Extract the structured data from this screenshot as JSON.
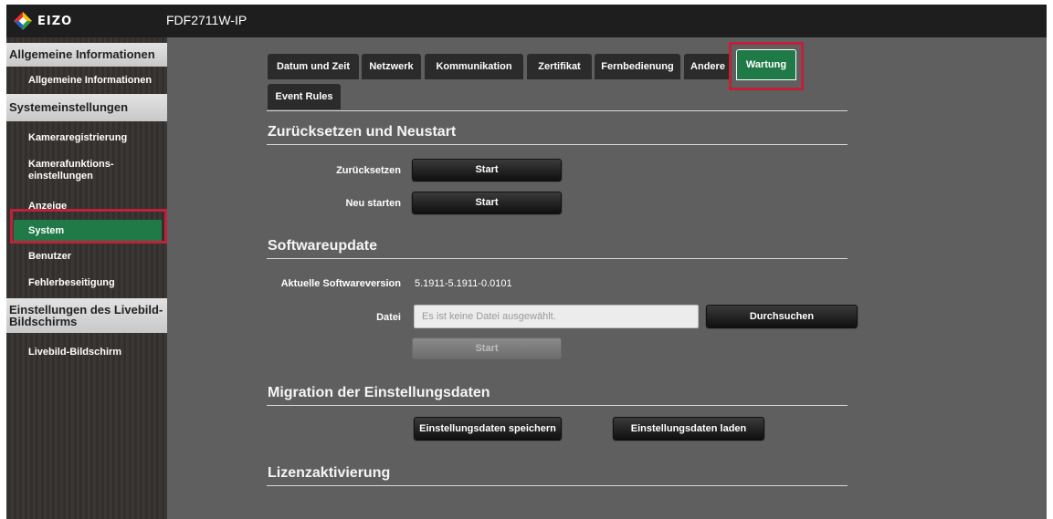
{
  "header": {
    "logo_text": "EIZO",
    "device_title": "FDF2711W-IP"
  },
  "sidebar": {
    "sections": [
      {
        "title": "Allgemeine Informationen",
        "items": [
          {
            "label": "Allgemeine Informationen"
          }
        ]
      },
      {
        "title": "Systemeinstellungen",
        "items": [
          {
            "label": "Kameraregistrierung"
          },
          {
            "label": "Kamerafunktions- einstellungen"
          },
          {
            "label": "Anzeige"
          },
          {
            "label": "System",
            "active": true
          },
          {
            "label": "Benutzer"
          },
          {
            "label": "Fehlerbeseitigung"
          }
        ]
      },
      {
        "title": "Einstellungen des Livebild-Bildschirms",
        "items": [
          {
            "label": "Livebild-Bildschirm"
          }
        ]
      }
    ]
  },
  "tabs": [
    {
      "label": "Datum und Zeit"
    },
    {
      "label": "Netzwerk"
    },
    {
      "label": "Kommunikation"
    },
    {
      "label": "Zertifikat"
    },
    {
      "label": "Fernbedienung"
    },
    {
      "label": "Andere"
    },
    {
      "label": "Wartung",
      "active": true
    },
    {
      "label": "Event Rules"
    }
  ],
  "reset_section": {
    "title": "Zurücksetzen und Neustart",
    "reset_label": "Zurücksetzen",
    "reset_button": "Start",
    "restart_label": "Neu starten",
    "restart_button": "Start"
  },
  "update_section": {
    "title": "Softwareupdate",
    "version_label": "Aktuelle Softwareversion",
    "version_value": "5.1911-5.1911-0.0101",
    "file_label": "Datei",
    "file_placeholder": "Es ist keine Datei ausgewählt.",
    "browse_button": "Durchsuchen",
    "start_button": "Start"
  },
  "migration_section": {
    "title": "Migration der Einstellungsdaten",
    "save_button": "Einstellungsdaten speichern",
    "load_button": "Einstellungsdaten laden"
  },
  "license_section": {
    "title": "Lizenzaktivierung"
  },
  "colors": {
    "accent": "#1f7a48",
    "highlight": "#c0203a",
    "topbar": "#1e1e1e",
    "main_bg": "#5f5f5f"
  },
  "icons": {
    "logo": "eizo-logo-icon"
  }
}
